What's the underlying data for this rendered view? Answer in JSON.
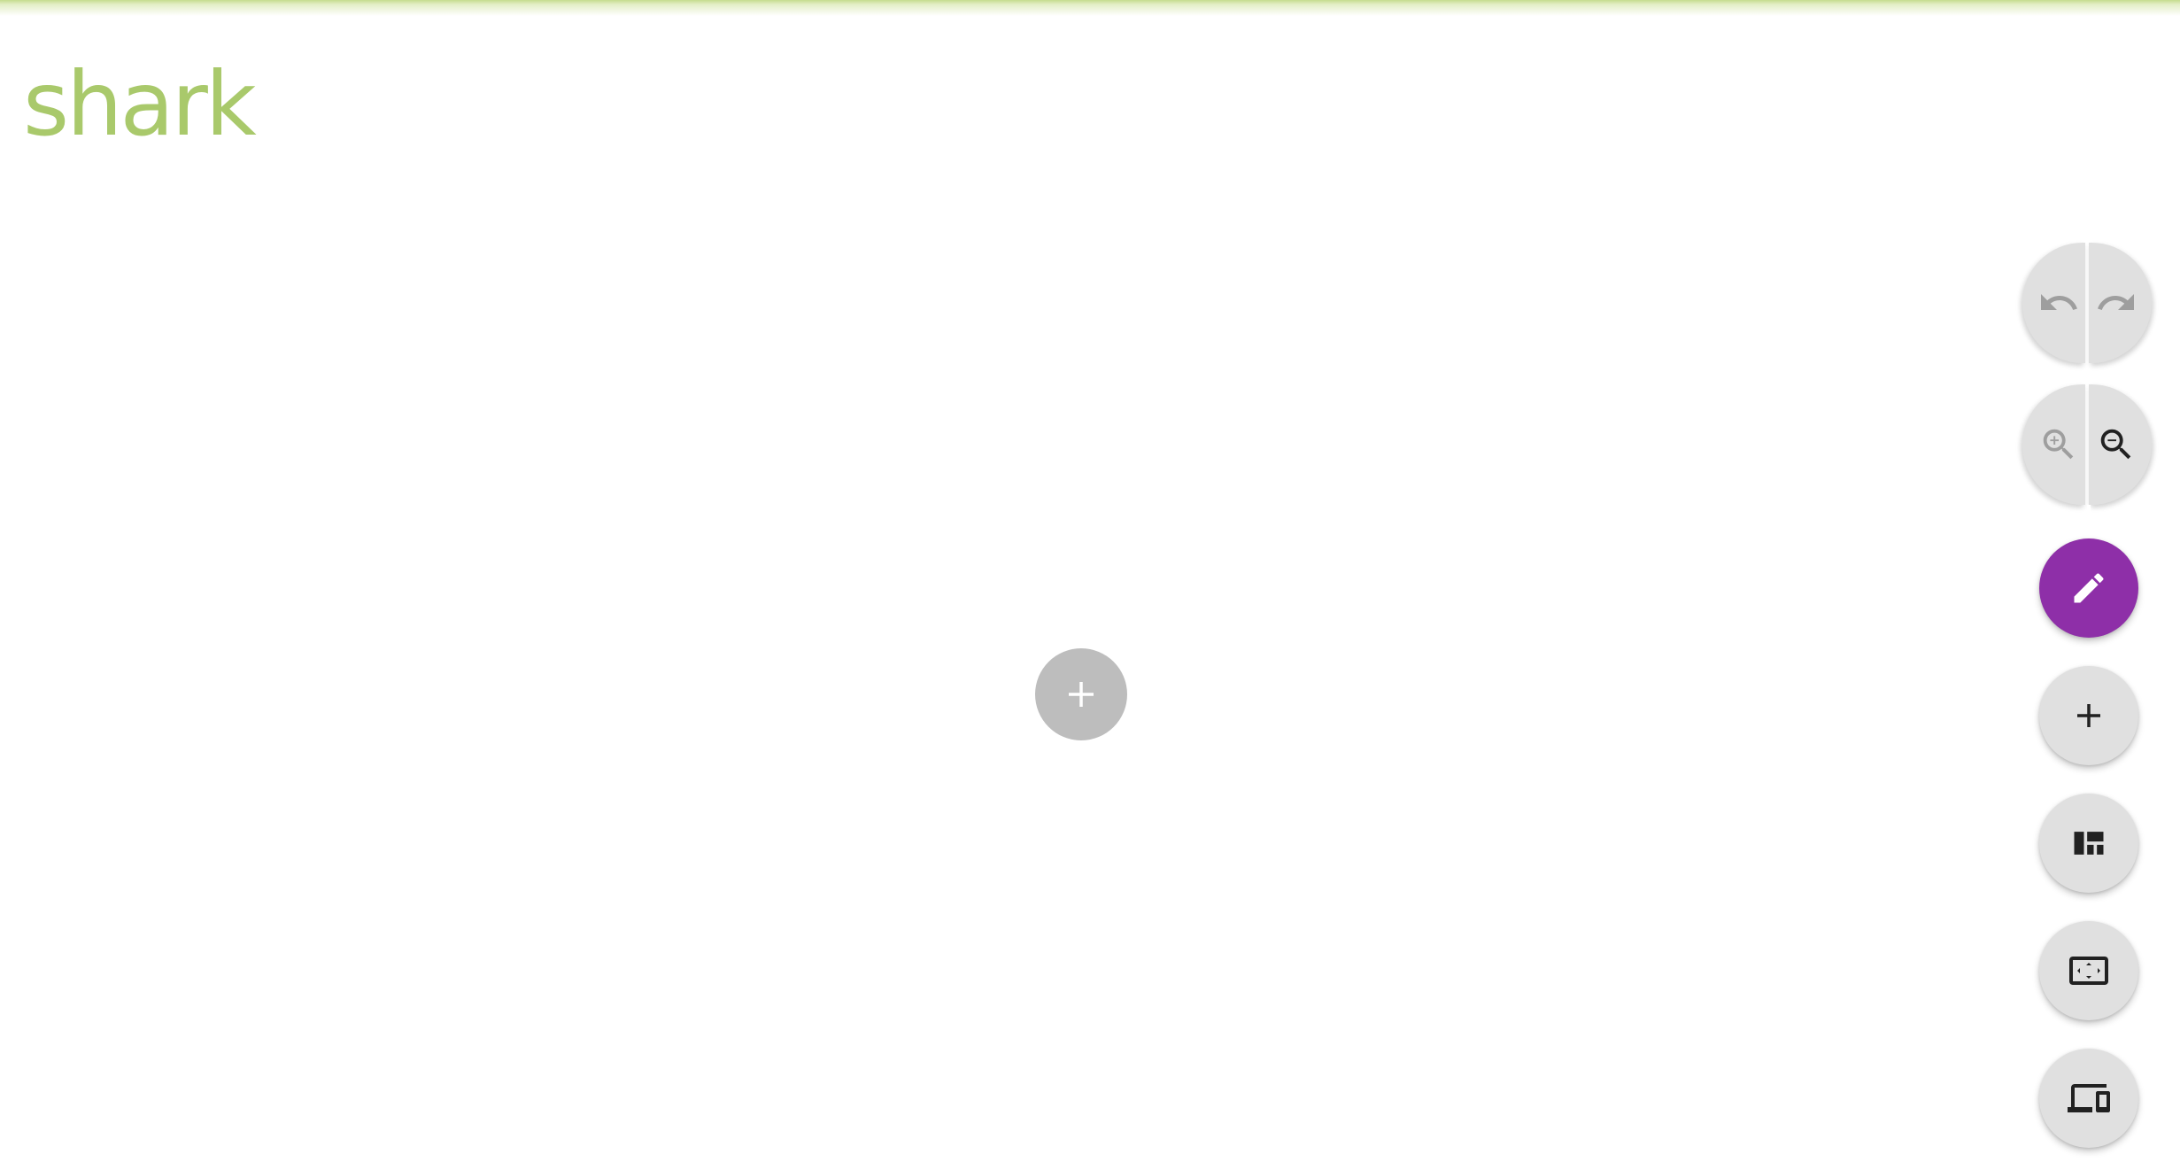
{
  "app": {
    "logo_text": "shark"
  },
  "colors": {
    "brand": "#a9c96b",
    "accent": "#8e2fa8",
    "fab_background": "#e0e0e0",
    "icon_disabled": "#9e9e9e",
    "icon_active": "#212121"
  },
  "canvas": {
    "center_add_icon": "plus-icon"
  },
  "toolbar": {
    "history": {
      "undo_icon": "undo-icon",
      "redo_icon": "redo-icon",
      "undo_enabled": false,
      "redo_enabled": false
    },
    "zoom": {
      "zoom_in_icon": "zoom-in-icon",
      "zoom_out_icon": "zoom-out-icon",
      "zoom_in_enabled": false,
      "zoom_out_enabled": true
    },
    "buttons": [
      {
        "name": "edit-button",
        "icon": "pencil-icon",
        "primary": true
      },
      {
        "name": "add-widget-button",
        "icon": "plus-icon",
        "primary": false
      },
      {
        "name": "layout-button",
        "icon": "dashboard-layout-icon",
        "primary": false
      },
      {
        "name": "fit-screen-button",
        "icon": "fit-screen-icon",
        "primary": false
      },
      {
        "name": "devices-button",
        "icon": "devices-icon",
        "primary": false
      }
    ]
  }
}
